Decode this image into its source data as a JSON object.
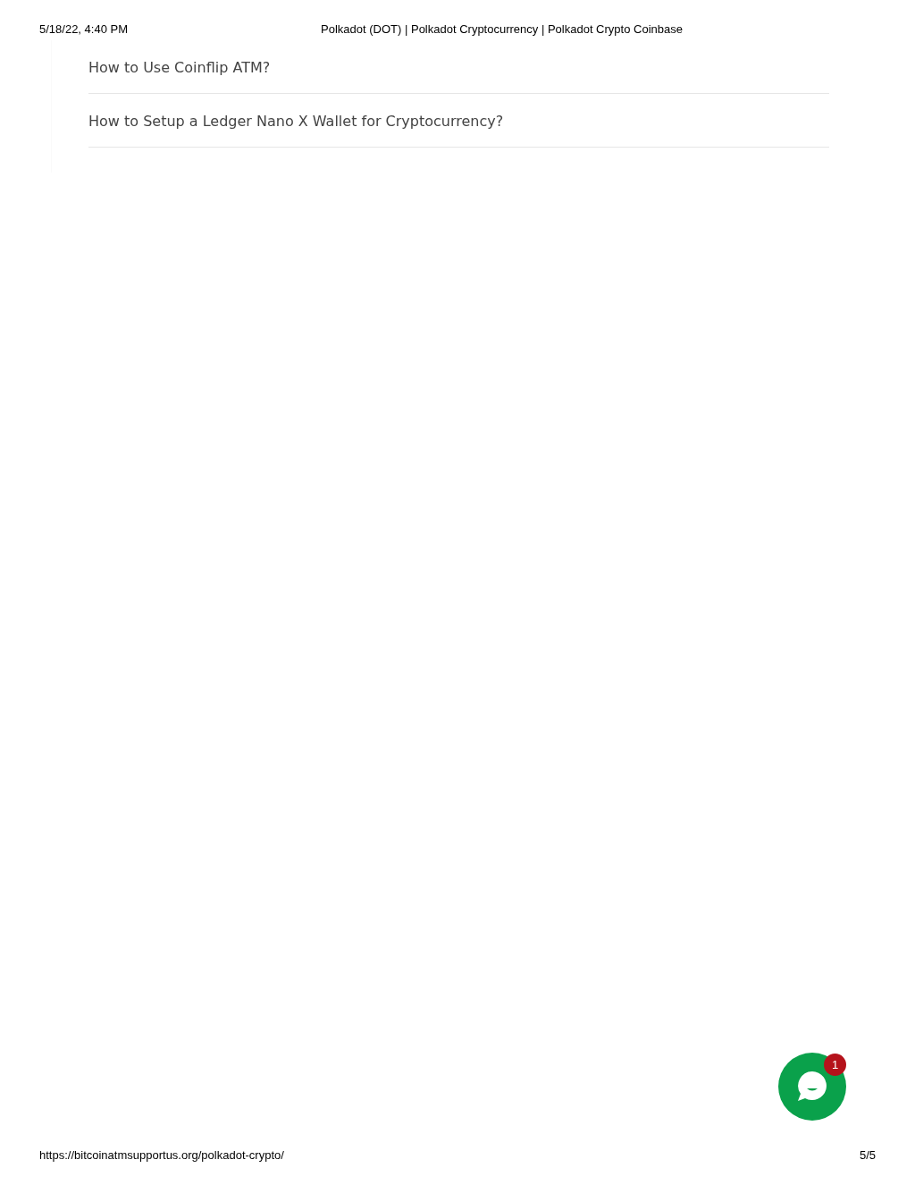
{
  "print_header": {
    "date": "5/18/22, 4:40 PM",
    "title": "Polkadot (DOT) | Polkadot Cryptocurrency | Polkadot Crypto Coinbase"
  },
  "links": [
    {
      "text": "How to Use Coinflip ATM?"
    },
    {
      "text": "How to Setup a Ledger Nano X Wallet for Cryptocurrency?"
    }
  ],
  "chat_button": {
    "badge": "1"
  },
  "print_footer": {
    "url": "https://bitcoinatmsupportus.org/polkadot-crypto/",
    "page": "5/5"
  }
}
